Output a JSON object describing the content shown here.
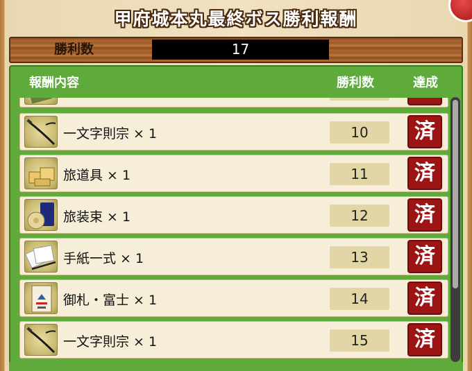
{
  "title": "甲府城本丸最終ボス勝利報酬",
  "wins_label": "勝利数",
  "wins_value": "17",
  "header": {
    "content": "報酬内容",
    "wins": "勝利数",
    "done": "達成"
  },
  "rows": [
    {
      "name": "",
      "wins": "",
      "stamp": "済",
      "icon": "partial-item-icon"
    },
    {
      "name": "一文字則宗 × 1",
      "wins": "10",
      "stamp": "済",
      "icon": "sword-icon"
    },
    {
      "name": "旅道具 × 1",
      "wins": "11",
      "stamp": "済",
      "icon": "travel-tools-icon"
    },
    {
      "name": "旅装束 × 1",
      "wins": "12",
      "stamp": "済",
      "icon": "travel-outfit-icon"
    },
    {
      "name": "手紙一式 × 1",
      "wins": "13",
      "stamp": "済",
      "icon": "letter-set-icon"
    },
    {
      "name": "御札・富士 × 1",
      "wins": "14",
      "stamp": "済",
      "icon": "talisman-icon"
    },
    {
      "name": "一文字則宗 × 1",
      "wins": "15",
      "stamp": "済",
      "icon": "sword-icon"
    }
  ],
  "colors": {
    "panel_green": "#5eaa3a",
    "stamp_red": "#9c1414",
    "wood": "#b06a32"
  },
  "rows_scroll": {
    "value": 0.8
  }
}
